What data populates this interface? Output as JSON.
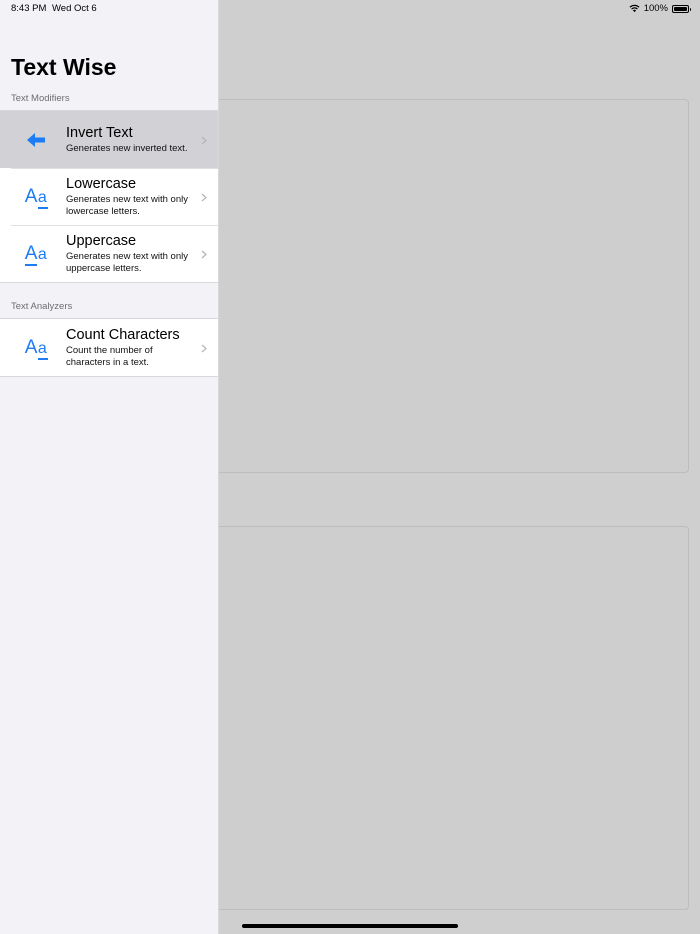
{
  "status_bar": {
    "time": "8:43 PM",
    "date": "Wed Oct 6",
    "battery": "100%",
    "battery_level": 1.0
  },
  "sidebar": {
    "title": "Text Wise",
    "sections": [
      {
        "header": "Text Modifiers",
        "items": [
          {
            "title": "Invert Text",
            "subtitle": "Generates new inverted text.",
            "icon": "arrow-left-icon",
            "selected": true
          },
          {
            "title": "Lowercase",
            "subtitle": "Generates new text with only lowercase letters.",
            "icon": "text-case-lower-icon",
            "selected": false
          },
          {
            "title": "Uppercase",
            "subtitle": "Generates new text with only uppercase letters.",
            "icon": "text-case-upper-icon",
            "selected": false
          }
        ]
      },
      {
        "header": "Text Analyzers",
        "items": [
          {
            "title": "Count Characters",
            "subtitle": "Count the number of characters in a text.",
            "icon": "text-case-icon",
            "selected": false
          }
        ]
      }
    ]
  },
  "colors": {
    "accent": "#1c7cf4",
    "sidebar_background": "#f2f2f7",
    "selected_row": "#d1d1d6",
    "dimmed_background": "#cfcfcf"
  }
}
